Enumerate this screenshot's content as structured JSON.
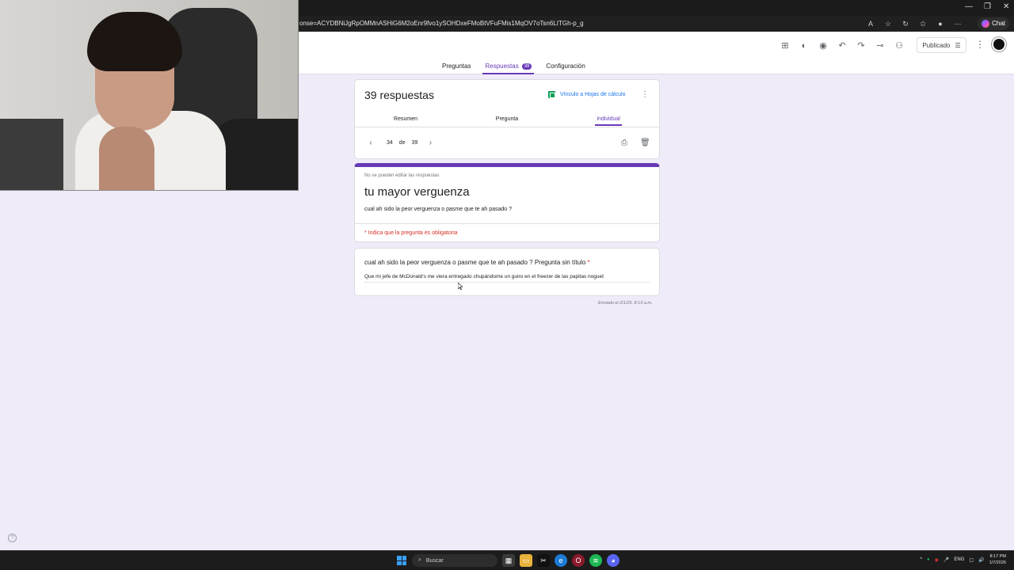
{
  "browser": {
    "url": "onse=ACYDBNiJgRpOMMnASHiG6M2oEnr9fvo1ySOHDxeFMoBtVFuFMis1MqOV7oTsn6LITGh-p_g",
    "chat_label": "Chat"
  },
  "toolbar": {
    "publish_label": "Publicado"
  },
  "tabs": [
    {
      "label": "Preguntas"
    },
    {
      "label": "Respuestas",
      "badge": "39"
    },
    {
      "label": "Configuración"
    }
  ],
  "summary": {
    "title": "39 respuestas",
    "sheets_link": "Vínculo a Hojas de cálculo",
    "subtabs": [
      "Resumen",
      "Pregunta",
      "Individual"
    ],
    "pager": {
      "current": "34",
      "of": "de",
      "total": "39"
    }
  },
  "form": {
    "readonly_note": "No se pueden editar las respuestas",
    "title": "tu mayor verguenza",
    "description": "cual ah sido la peor verguenza o pasme que te ah pasado ?",
    "required_note": "* Indica que la pregunta es obligatoria"
  },
  "response": {
    "question": "cual ah sido la peor verguenza o pasme que te ah pasado ?  Pregunta sin título",
    "required_mark": "*",
    "answer": "Que mi jefe de McDonald's me viera entregado chupándome un guiro en el freezer de las papitas noguet",
    "sent_on": "Enviado el 2/1/26, 8:13 a.m."
  },
  "taskbar": {
    "search_placeholder": "Buscar",
    "lang": "ENG",
    "time": "8:17 PM",
    "date": "1/7/2026"
  },
  "colors": {
    "accent": "#673ab7",
    "page_bg": "#f0ebf8",
    "required": "#d93025"
  }
}
